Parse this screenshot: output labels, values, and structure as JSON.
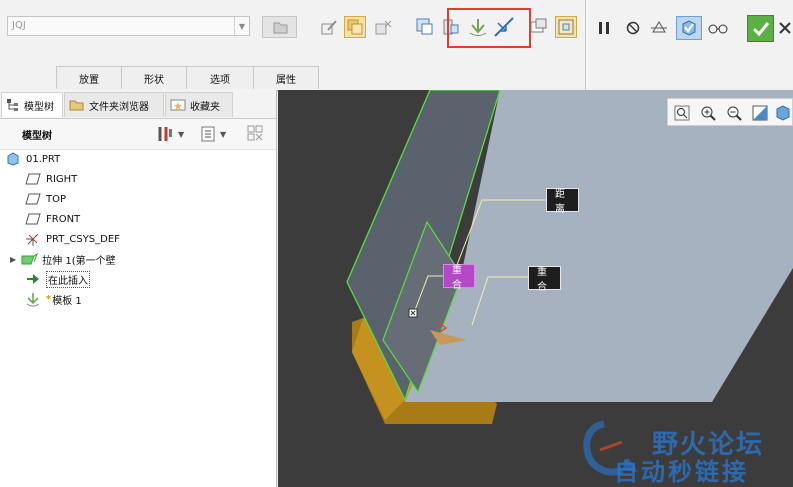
{
  "toolbar": {
    "reference_combo": {
      "value": "JQJ",
      "placeholder": ""
    },
    "tabs": [
      {
        "label": "放置"
      },
      {
        "label": "形状"
      },
      {
        "label": "选项"
      },
      {
        "label": "属性"
      }
    ],
    "icons": [
      "edit-sketch-icon",
      "reference-plane-icon",
      "flip-icon",
      "offset-surface-icon",
      "midplane-icon",
      "template-icon",
      "flip-direction-icon",
      "option-a-icon",
      "option-b-icon"
    ],
    "right_controls": [
      "pause-icon",
      "no-entry-icon",
      "preview-icon",
      "verify-icon",
      "glasses-icon",
      "confirm-checkmark-icon",
      "cancel-x-icon"
    ],
    "accent_highlight": "#e53a2e"
  },
  "panel_tabs": [
    {
      "label": "模型树"
    },
    {
      "label": "文件夹浏览器"
    },
    {
      "label": "收藏夹"
    }
  ],
  "tree": {
    "header": "模型树",
    "items": [
      {
        "label": "01.PRT",
        "icon": "part-icon"
      },
      {
        "label": "RIGHT",
        "icon": "datum-plane-icon"
      },
      {
        "label": "TOP",
        "icon": "datum-plane-icon"
      },
      {
        "label": "FRONT",
        "icon": "datum-plane-icon"
      },
      {
        "label": "PRT_CSYS_DEF",
        "icon": "coordinate-system-icon"
      },
      {
        "label": "拉伸 1(第一个壁",
        "icon": "extrude-icon"
      },
      {
        "label": "在此插入",
        "icon": "insert-here-arrow-icon"
      },
      {
        "label": "模板 1",
        "icon": "template-feature-icon"
      }
    ]
  },
  "viewport": {
    "callouts": [
      {
        "label": "距离"
      },
      {
        "label": "重合"
      },
      {
        "label": "重合"
      }
    ],
    "view_tools": [
      "zoom-fit-icon",
      "zoom-in-icon",
      "zoom-out-icon",
      "repaint-icon",
      "display-style-icon"
    ]
  },
  "watermark": {
    "line1": "野火论坛",
    "line2": "自动秒链接"
  }
}
